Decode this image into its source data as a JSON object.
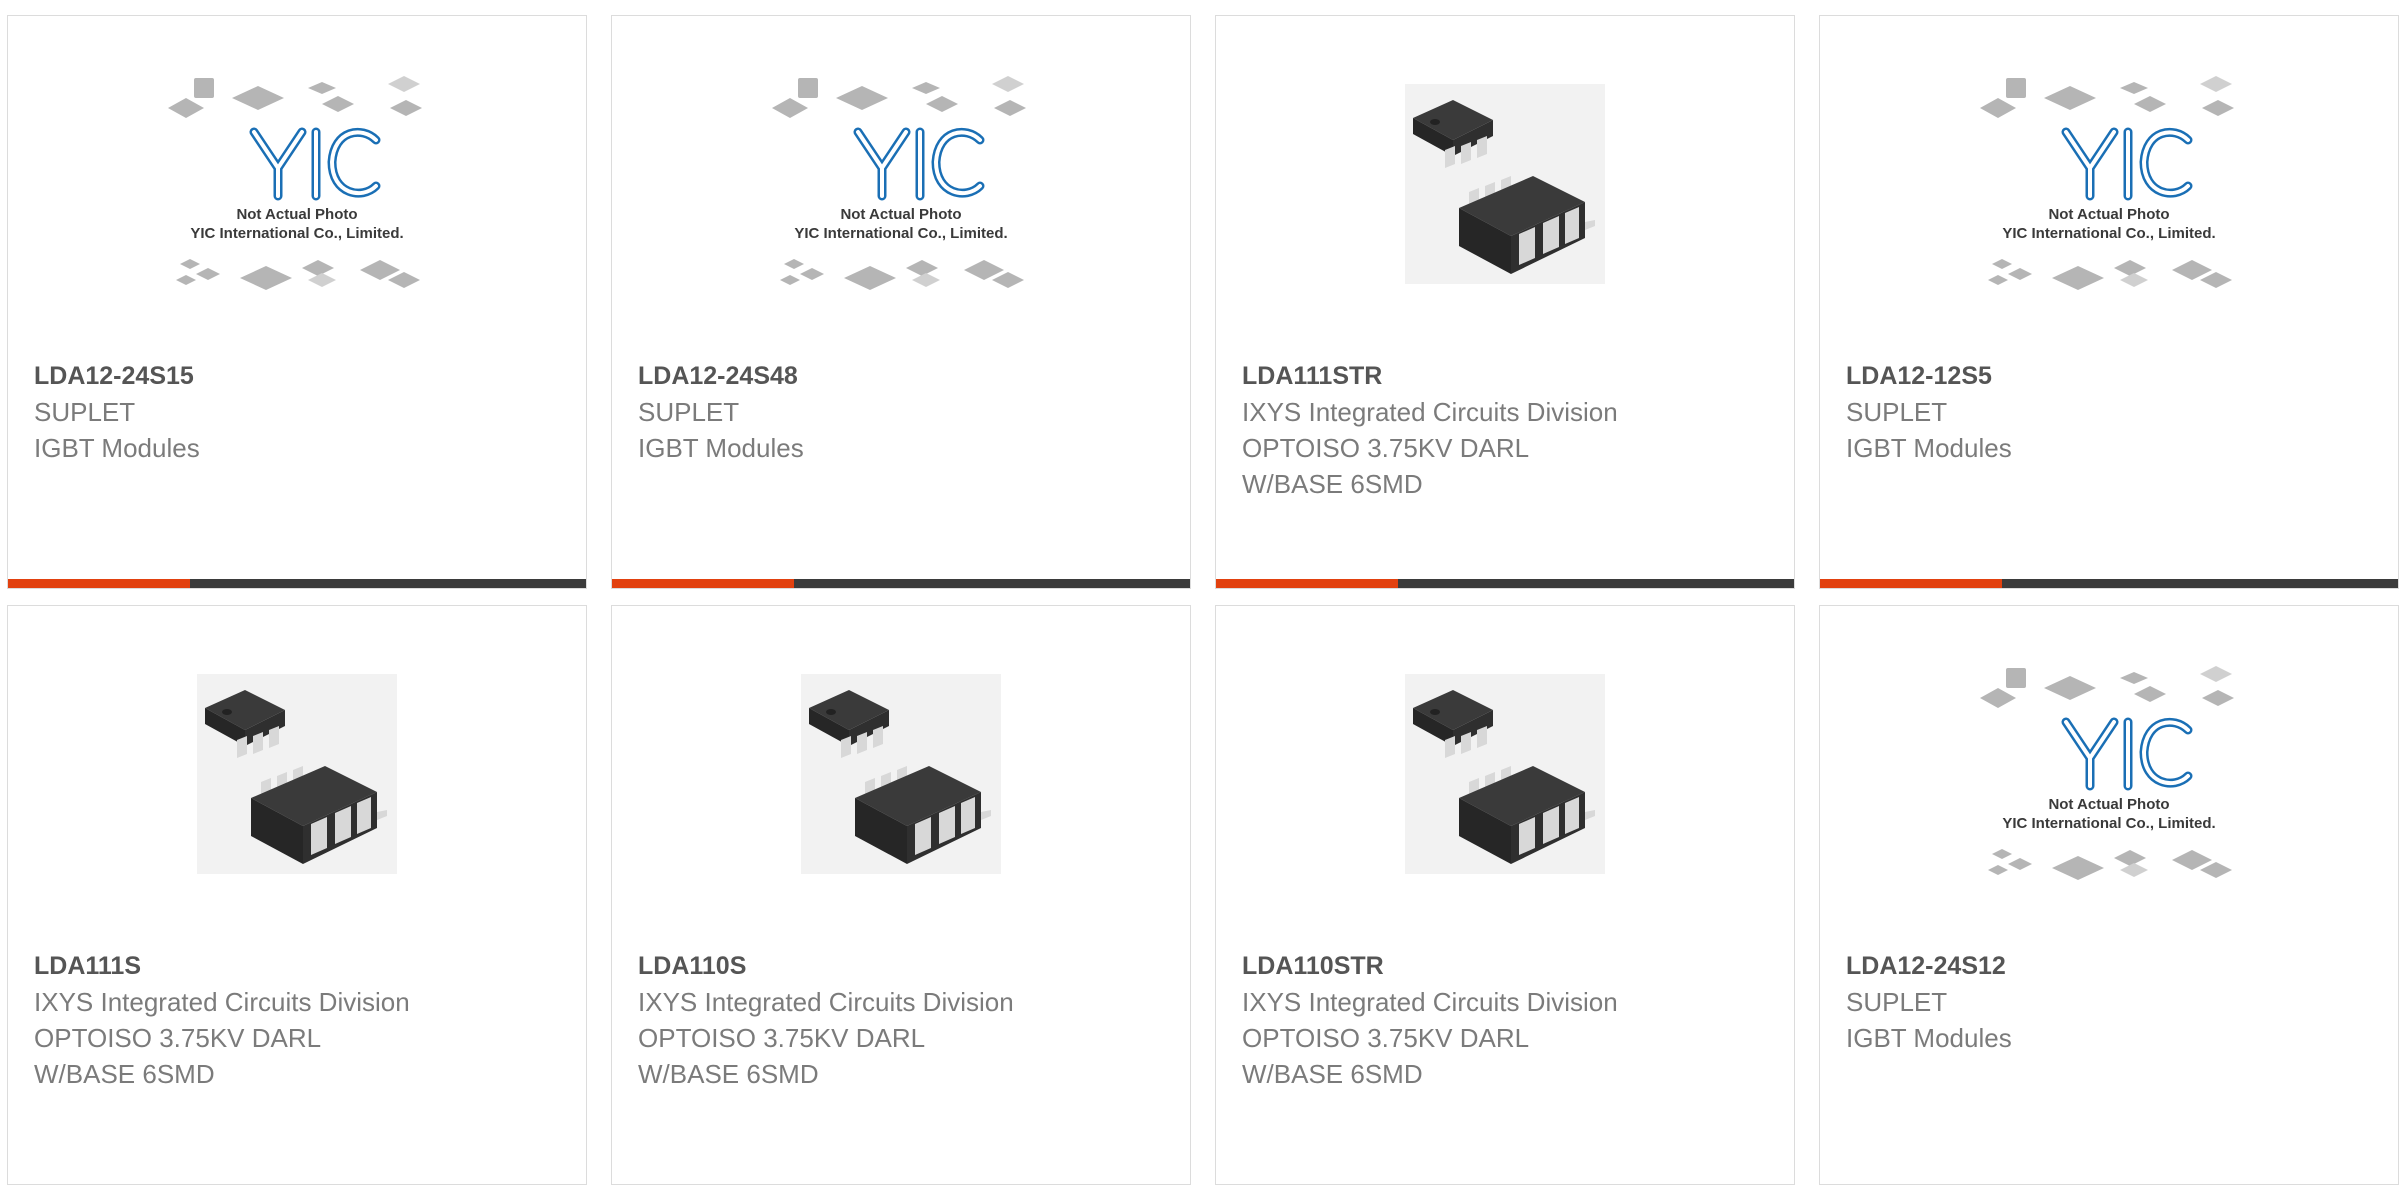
{
  "placeholder": {
    "logo_text": "YIC",
    "caption_line1": "Not Actual Photo",
    "caption_line2": "YIC International Co., Limited."
  },
  "colors": {
    "accent": "#e2410f",
    "bar_dark": "#3b3b3b",
    "border": "#dcdcdc",
    "part_number": "#555555",
    "text": "#7b7b7b",
    "logo_blue": "#1a6fb5"
  },
  "products": [
    {
      "part_number": "LDA12-24S15",
      "lines": [
        "SUPLET",
        "IGBT Modules",
        ""
      ],
      "image": "placeholder-image",
      "has_bar": true
    },
    {
      "part_number": "LDA12-24S48",
      "lines": [
        "SUPLET",
        "IGBT Modules",
        ""
      ],
      "image": "placeholder-image",
      "has_bar": true
    },
    {
      "part_number": "LDA111STR",
      "lines": [
        "IXYS Integrated Circuits Division",
        "OPTOISO 3.75KV DARL",
        "W/BASE 6SMD"
      ],
      "image": "smd-chip-image",
      "has_bar": true
    },
    {
      "part_number": "LDA12-12S5",
      "lines": [
        "SUPLET",
        "IGBT Modules",
        ""
      ],
      "image": "placeholder-image",
      "has_bar": true
    },
    {
      "part_number": "LDA111S",
      "lines": [
        "IXYS Integrated Circuits Division",
        "OPTOISO 3.75KV DARL",
        "W/BASE 6SMD"
      ],
      "image": "smd-chip-image",
      "has_bar": false
    },
    {
      "part_number": "LDA110S",
      "lines": [
        "IXYS Integrated Circuits Division",
        "OPTOISO 3.75KV DARL",
        "W/BASE 6SMD"
      ],
      "image": "smd-chip-image",
      "has_bar": false
    },
    {
      "part_number": "LDA110STR",
      "lines": [
        "IXYS Integrated Circuits Division",
        "OPTOISO 3.75KV DARL",
        "W/BASE 6SMD"
      ],
      "image": "smd-chip-image",
      "has_bar": false
    },
    {
      "part_number": "LDA12-24S12",
      "lines": [
        "SUPLET",
        "IGBT Modules",
        ""
      ],
      "image": "placeholder-image",
      "has_bar": false
    }
  ]
}
